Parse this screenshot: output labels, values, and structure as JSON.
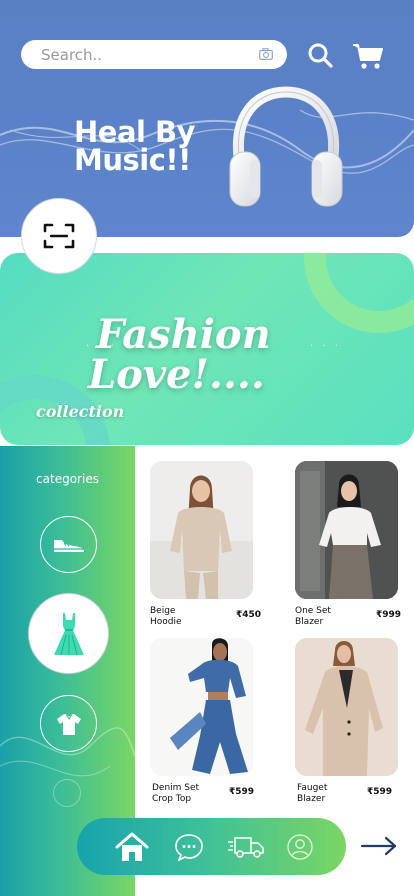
{
  "header": {
    "search": {
      "placeholder": "Search..",
      "value": ""
    },
    "icons": {
      "camera": "camera-icon",
      "search": "search-icon",
      "cart": "cart-icon"
    },
    "banner_title": "Heal By Music!!",
    "colors": {
      "banner_bg": "#5b82c8"
    }
  },
  "scan": {
    "icon": "scan-icon"
  },
  "fashion_banner": {
    "title_line1": "Fashion",
    "title_line2": "Love!....",
    "subtitle": "collection",
    "colors": {
      "bg_start": "#55dcc1",
      "bg_end": "#6fe6b6"
    }
  },
  "categories": {
    "label": "categories",
    "items": [
      {
        "icon": "shoe-icon",
        "active": false
      },
      {
        "icon": "dress-icon",
        "active": true
      },
      {
        "icon": "tshirt-icon",
        "active": false
      }
    ]
  },
  "products": [
    {
      "name_line1": "Beige",
      "name_line2": "Hoodie",
      "price": "₹450"
    },
    {
      "name_line1": "One Set",
      "name_line2": "Blazer",
      "price": "₹999"
    },
    {
      "name_line1": "Denim Set",
      "name_line2": "Crop Top",
      "price": "₹599"
    },
    {
      "name_line1": "Fauget",
      "name_line2": "Blazer",
      "price": "₹599"
    }
  ],
  "bottom_nav": {
    "items": [
      {
        "icon": "home-icon",
        "active": true
      },
      {
        "icon": "chat-icon",
        "active": false
      },
      {
        "icon": "delivery-truck-icon",
        "active": false
      },
      {
        "icon": "profile-icon",
        "active": false
      }
    ],
    "next": "arrow-right-icon"
  }
}
